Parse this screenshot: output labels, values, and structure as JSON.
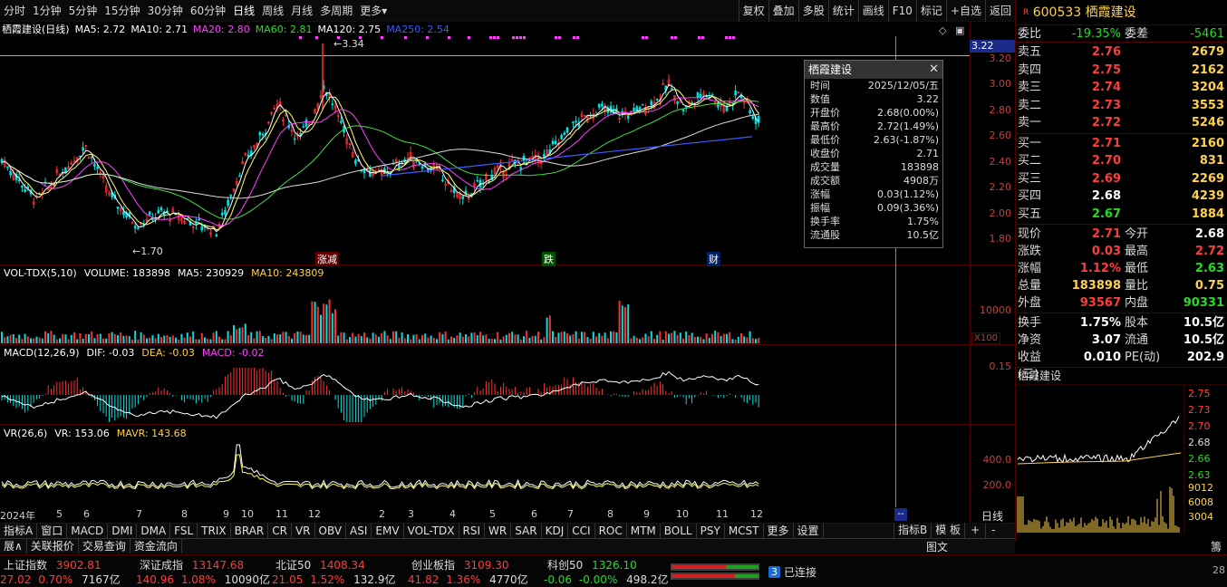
{
  "periods": [
    "分时",
    "1分钟",
    "5分钟",
    "15分钟",
    "30分钟",
    "60分钟",
    "日线",
    "周线",
    "月线",
    "多周期",
    "更多"
  ],
  "active_period": "日线",
  "tools": [
    "复权",
    "叠加",
    "多股",
    "统计",
    "画线",
    "F10",
    "标记",
    "+自选",
    "返回"
  ],
  "kline_header": {
    "name": "栖霞建设(日线)",
    "ma5": "MA5: 2.72",
    "ma10": "MA10: 2.71",
    "ma20": "MA20: 2.80",
    "ma60": "MA60: 2.81",
    "ma120": "MA120: 2.75",
    "ma250": "MA250: 2.54"
  },
  "kline_axis": [
    "3.20",
    "3.00",
    "2.80",
    "2.60",
    "2.40",
    "2.20",
    "2.00",
    "1.80"
  ],
  "kline_cursor_price": "3.22",
  "kline_high_label": "3.34",
  "kline_low_label": "1.70",
  "kline_markers": [
    "涨减",
    "跌",
    "财"
  ],
  "vol_header": {
    "name": "VOL-TDX(5,10)",
    "volume": "VOLUME: 183898",
    "ma5": "MA5: 230929",
    "ma10": "MA10: 243809"
  },
  "vol_axis": [
    "10000"
  ],
  "vol_unit": "X100",
  "macd_header": {
    "name": "MACD(12,26,9)",
    "dif": "DIF: -0.03",
    "dea": "DEA: -0.03",
    "macd": "MACD: -0.02"
  },
  "macd_axis": [
    "0.15"
  ],
  "vr_header": {
    "name": "VR(26,6)",
    "vr": "VR: 153.06",
    "mavr": "MAVR: 143.68"
  },
  "vr_axis": [
    "400.0",
    "200.0"
  ],
  "x_labels": [
    "2024年",
    "5",
    "6",
    "7",
    "8",
    "9",
    "10",
    "11",
    "12",
    "2",
    "3",
    "4",
    "5",
    "6",
    "7",
    "8",
    "9",
    "10",
    "11",
    "12"
  ],
  "x_cursor": "--",
  "x_period_label": "日线",
  "tooltip": {
    "title": "栖霞建设",
    "rows": [
      {
        "k": "时间",
        "v": "2025/12/05/五",
        "c": "w"
      },
      {
        "k": "数值",
        "v": "3.22",
        "c": "w"
      },
      {
        "k": "开盘价",
        "v": "2.68(0.00%)",
        "c": "w"
      },
      {
        "k": "最高价",
        "v": "2.72(1.49%)",
        "c": "r"
      },
      {
        "k": "最低价",
        "v": "2.63(-1.87%)",
        "c": "g"
      },
      {
        "k": "收盘价",
        "v": "2.71",
        "c": "r"
      },
      {
        "k": "成交量",
        "v": "183898",
        "c": "w"
      },
      {
        "k": "成交额",
        "v": "4908万",
        "c": "w"
      },
      {
        "k": "涨幅",
        "v": "0.03(1.12%)",
        "c": "r"
      },
      {
        "k": "振幅",
        "v": "0.09(3.36%)",
        "c": "w"
      },
      {
        "k": "换手率",
        "v": "1.75%",
        "c": "w"
      },
      {
        "k": "流通股",
        "v": "10.5亿",
        "c": "w"
      }
    ]
  },
  "stock": {
    "badge": "R",
    "code": "600533",
    "name": "栖霞建设",
    "webi_label": "委比",
    "webi": "-19.35%",
    "weicha_label": "委差",
    "weicha": "-5461",
    "sells": [
      {
        "l": "卖五",
        "p": "2.76",
        "v": "2679"
      },
      {
        "l": "卖四",
        "p": "2.75",
        "v": "2162"
      },
      {
        "l": "卖三",
        "p": "2.74",
        "v": "3204"
      },
      {
        "l": "卖二",
        "p": "2.73",
        "v": "3553"
      },
      {
        "l": "卖一",
        "p": "2.72",
        "v": "5246"
      }
    ],
    "buys": [
      {
        "l": "买一",
        "p": "2.71",
        "v": "2160",
        "c": "red"
      },
      {
        "l": "买二",
        "p": "2.70",
        "v": "831",
        "c": "red"
      },
      {
        "l": "买三",
        "p": "2.69",
        "v": "2269",
        "c": "red"
      },
      {
        "l": "买四",
        "p": "2.68",
        "v": "4239",
        "c": "white"
      },
      {
        "l": "买五",
        "p": "2.67",
        "v": "1884",
        "c": "green"
      }
    ],
    "quote1": [
      {
        "l": "现价",
        "v": "2.71",
        "vc": "red",
        "l2": "今开",
        "v2": "2.68",
        "v2c": "white"
      },
      {
        "l": "涨跌",
        "v": "0.03",
        "vc": "red",
        "l2": "最高",
        "v2": "2.72",
        "v2c": "red"
      },
      {
        "l": "涨幅",
        "v": "1.12%",
        "vc": "red",
        "l2": "最低",
        "v2": "2.63",
        "v2c": "green"
      },
      {
        "l": "总量",
        "v": "183898",
        "vc": "yellow",
        "l2": "量比",
        "v2": "0.75",
        "v2c": "yellow"
      },
      {
        "l": "外盘",
        "v": "93567",
        "vc": "red",
        "l2": "内盘",
        "v2": "90331",
        "v2c": "green"
      }
    ],
    "quote2": [
      {
        "l": "换手",
        "v": "1.75%",
        "vc": "white",
        "l2": "股本",
        "v2": "10.5亿",
        "v2c": "white"
      },
      {
        "l": "净资",
        "v": "3.07",
        "vc": "white",
        "l2": "流通",
        "v2": "10.5亿",
        "v2c": "white"
      },
      {
        "l": "收益(三)",
        "v": "0.010",
        "vc": "white",
        "l2": "PE(动)",
        "v2": "202.9",
        "v2c": "white"
      }
    ],
    "mini_title": "栖霞建设",
    "mini_price_axis": [
      "2.75",
      "2.73",
      "2.70",
      "2.68",
      "2.66",
      "2.63"
    ],
    "mini_vol_axis": [
      "9012",
      "6008",
      "3004"
    ]
  },
  "indicator_tabs": [
    "指标A",
    "窗口",
    "MACD",
    "DMI",
    "DMA",
    "FSL",
    "TRIX",
    "BRAR",
    "CR",
    "VR",
    "OBV",
    "ASI",
    "EMV",
    "VOL-TDX",
    "RSI",
    "WR",
    "SAR",
    "KDJ",
    "CCI",
    "ROC",
    "MTM",
    "BOLL",
    "PSY",
    "MCST",
    "更多",
    "设置"
  ],
  "right_tabs": [
    "指标B",
    "模 板",
    "+",
    "-"
  ],
  "related_tabs": [
    "展∧",
    "关联报价",
    "交易查询",
    "资金流向"
  ],
  "status_indices": [
    {
      "name": "上证指数",
      "price": "3902.81",
      "chg": "27.02",
      "pct": "0.70%",
      "amt": "7167亿",
      "c": "red"
    },
    {
      "name": "深证成指",
      "price": "13147.68",
      "chg": "140.96",
      "pct": "1.08%",
      "amt": "10090亿",
      "c": "red"
    },
    {
      "name": "北证50",
      "price": "1408.34",
      "chg": "21.05",
      "pct": "1.52%",
      "amt": "132.9亿",
      "c": "red"
    },
    {
      "name": "创业板指",
      "price": "3109.30",
      "chg": "41.82",
      "pct": "1.36%",
      "amt": "4770亿",
      "c": "red"
    },
    {
      "name": "科创50",
      "price": "1326.10",
      "chg": "-0.06",
      "pct": "-0.00%",
      "amt": "498.2亿",
      "c": "green"
    }
  ],
  "connection": {
    "count": "3",
    "label": "已连接"
  },
  "corner_labels": [
    "图文",
    "籌"
  ],
  "status_time": "28"
}
